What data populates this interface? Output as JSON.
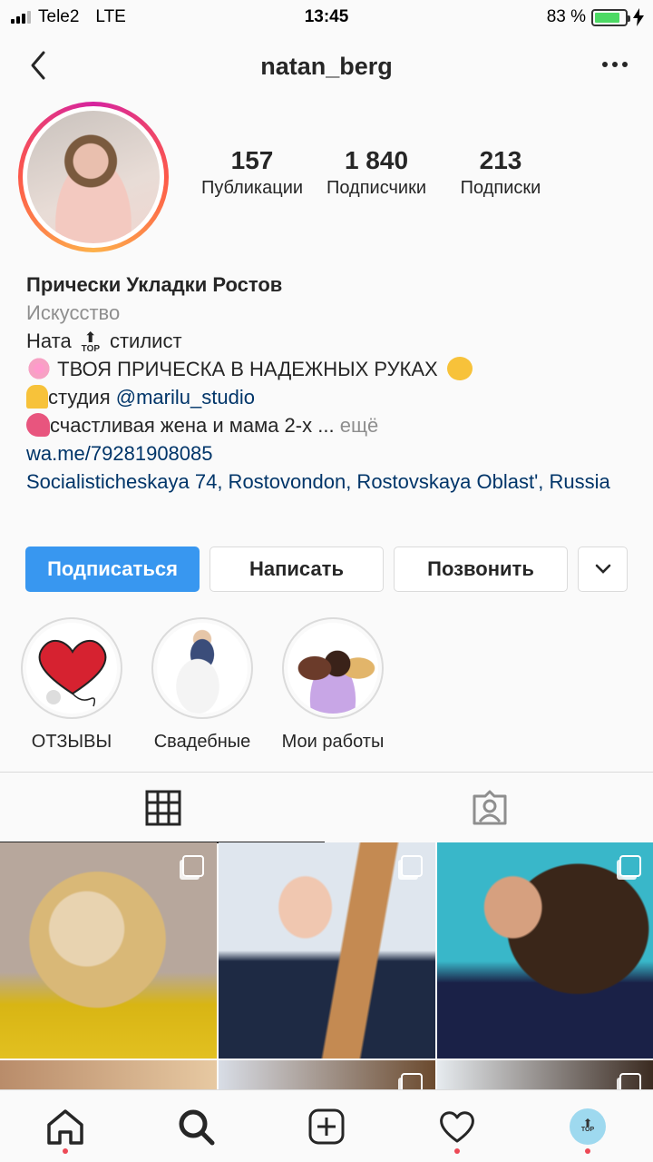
{
  "status": {
    "carrier": "Tele2",
    "network": "LTE",
    "time": "13:45",
    "battery": "83 %",
    "battery_level": 0.83,
    "battery_color": "#4cd964"
  },
  "nav": {
    "title": "natan_berg",
    "back_icon": "chevron-left-icon",
    "more_icon": "more-horizontal-icon"
  },
  "stats": [
    {
      "num": "157",
      "label": "Публикации"
    },
    {
      "num": "1 840",
      "label": "Подписчики"
    },
    {
      "num": "213",
      "label": "Подписки"
    }
  ],
  "bio": {
    "name": "Прически Укладки Ростов",
    "category": "Искусство",
    "line1_a": "Ната",
    "top_badge": "TOP",
    "line1_b": "стилист",
    "line2": "ТВОЯ ПРИЧЕСКА В НАДЕЖНЫХ РУКАХ",
    "line3_a": "студия",
    "line3_link": "@marilu_studio",
    "line4": "счастливая жена и мама 2-х ...",
    "more": "ещё",
    "website": "wa.me/79281908085",
    "address": "Socialisticheskaya 74, Rostovondon, Rostovskaya Oblast', Russia"
  },
  "buttons": {
    "follow": "Подписаться",
    "message": "Написать",
    "call": "Позвонить"
  },
  "highlights": [
    {
      "label": "ОТЗЫВЫ"
    },
    {
      "label": "Свадебные"
    },
    {
      "label": "Мои работы"
    }
  ],
  "tabs": {
    "grid_icon": "grid-icon",
    "tagged_icon": "tagged-person-icon"
  },
  "colors": {
    "accent": "#3897f0",
    "link": "#003569",
    "muted": "#8e8e8e",
    "notification": "#ed4956"
  },
  "bottom_nav": {
    "home": "home-icon",
    "search": "search-icon",
    "add": "add-post-icon",
    "activity": "heart-icon",
    "profile": "profile-avatar"
  }
}
